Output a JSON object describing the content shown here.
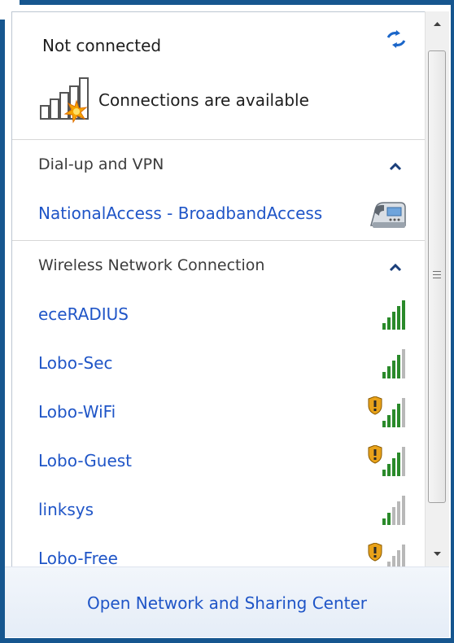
{
  "status": {
    "title": "Not connected",
    "connections_text": "Connections are available"
  },
  "icons": {
    "refresh": "refresh-arrows-icon",
    "connections": "signal-bars-with-star-icon",
    "phone": "dial-up-modem-icon",
    "security": "security-shield-icon"
  },
  "colors": {
    "window_border": "#16568f",
    "link": "#1f55c7",
    "signal_green": "#2a8a2a",
    "signal_gray": "#b8b8b8",
    "shield_gold": "#e8a21a"
  },
  "groups": [
    {
      "header": "Dial-up and VPN",
      "expanded": true,
      "items": [
        {
          "name": "NationalAccess - BroadbandAccess",
          "kind": "dial-up"
        }
      ]
    },
    {
      "header": "Wireless Network Connection",
      "expanded": true,
      "items": [
        {
          "name": "eceRADIUS",
          "signal_bars": 5,
          "secured": false
        },
        {
          "name": "Lobo-Sec",
          "signal_bars": 4,
          "secured": false
        },
        {
          "name": "Lobo-WiFi",
          "signal_bars": 4,
          "secured": true
        },
        {
          "name": "Lobo-Guest",
          "signal_bars": 4,
          "secured": true
        },
        {
          "name": "linksys",
          "signal_bars": 2,
          "secured": false
        },
        {
          "name": "Lobo-Free",
          "signal_bars": 1,
          "secured": true
        }
      ]
    }
  ],
  "footer": {
    "link": "Open Network and Sharing Center"
  }
}
